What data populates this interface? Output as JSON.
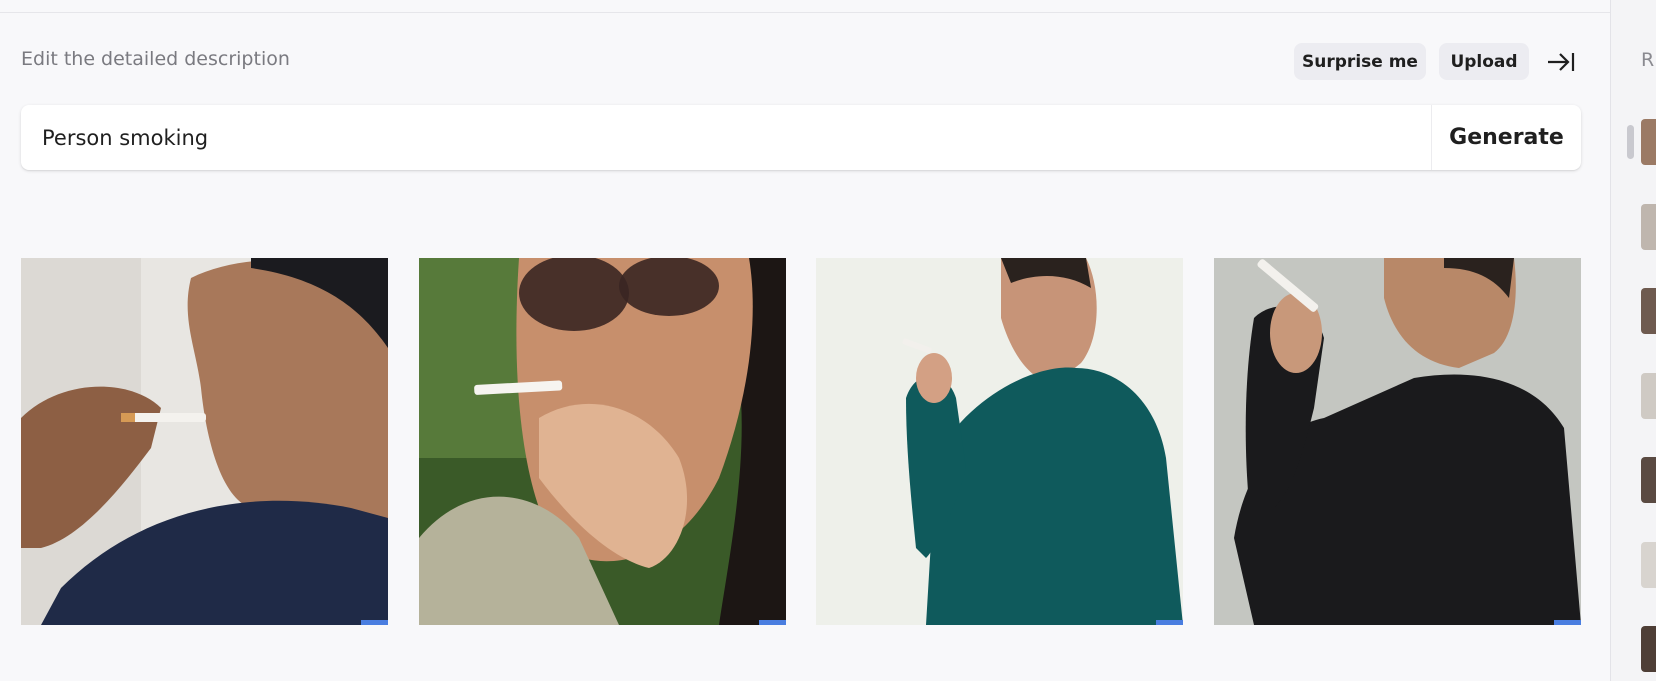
{
  "editor": {
    "heading": "Edit the detailed description",
    "surprise_label": "Surprise me",
    "upload_label": "Upload",
    "prompt_value": "Person smoking",
    "generate_label": "Generate"
  },
  "results": [
    {
      "name": "generated-image-1",
      "subject": "man in navy polo holding cigarette to mouth"
    },
    {
      "name": "generated-image-2",
      "subject": "woman in sunglasses smoking outdoors"
    },
    {
      "name": "generated-image-3",
      "subject": "man in teal sweater holding cigarette"
    },
    {
      "name": "generated-image-4",
      "subject": "man in black shirt holding cigarette"
    }
  ],
  "history_sidebar": {
    "label_partial": "R"
  },
  "colors": {
    "background": "#f8f8fa",
    "button_bg": "#ececf1",
    "text_primary": "#1f1f1f",
    "text_muted": "#7a7a80"
  }
}
